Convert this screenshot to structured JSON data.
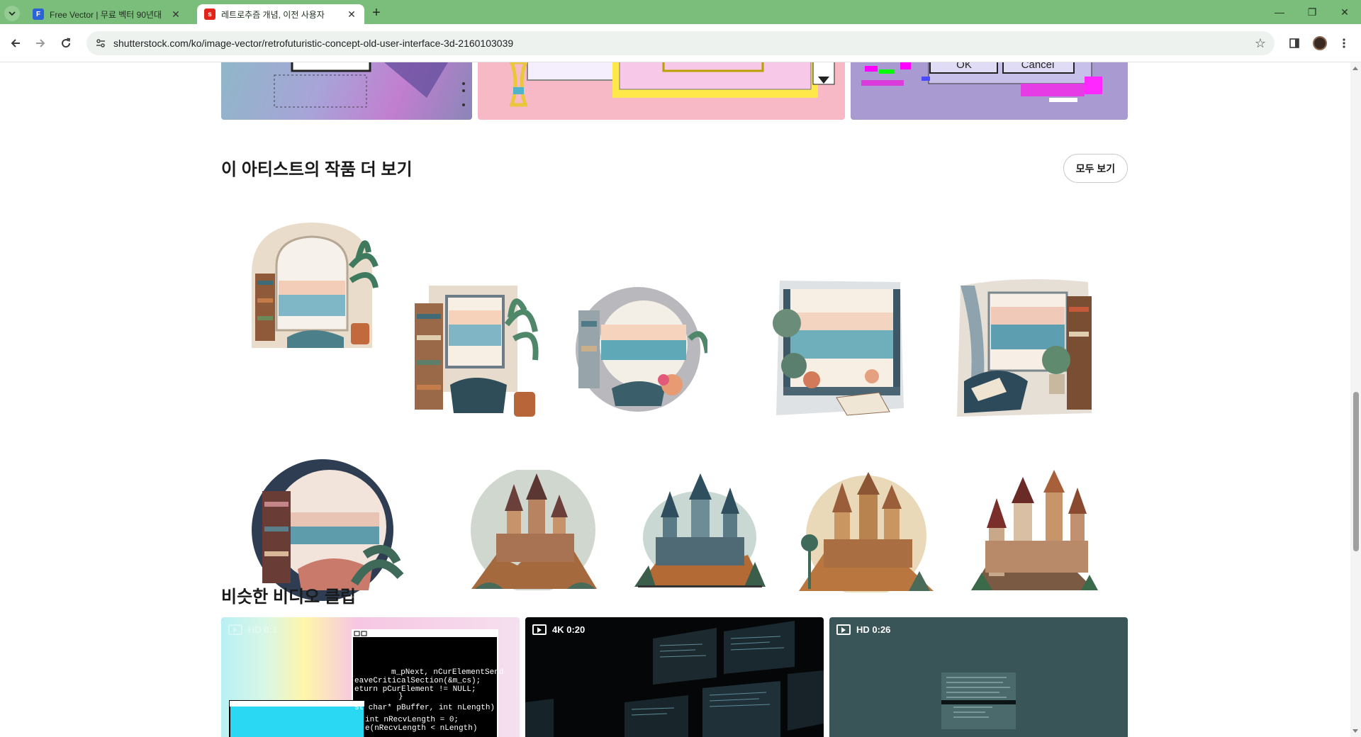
{
  "browser": {
    "tabs": [
      {
        "title": "Free Vector | 무료 벡터 90년대",
        "favicon": "freepik-favicon",
        "active": false
      },
      {
        "title": "레트로추즘 개념, 이전 사용자",
        "favicon": "shutterstock-favicon",
        "active": true
      }
    ],
    "url": "shutterstock.com/ko/image-vector/retrofuturistic-concept-old-user-interface-3d-2160103039"
  },
  "artist_section": {
    "title": "이 아티스트의 작품 더 보기",
    "see_all_label": "모두 보기",
    "images": [
      {
        "name": "artwork-arched-window-sea-room",
        "alt": "arched window sea room watercolor"
      },
      {
        "name": "artwork-open-window-reading-chair",
        "alt": "open window reading chair watercolor"
      },
      {
        "name": "artwork-porthole-sea-view",
        "alt": "porthole sea view watercolor"
      },
      {
        "name": "artwork-window-sea-books",
        "alt": "window with sea and books watercolor"
      },
      {
        "name": "artwork-window-sea-plants",
        "alt": "window sea and plants watercolor"
      },
      {
        "name": "artwork-round-window-reading-nook",
        "alt": "round window reading nook watercolor"
      },
      {
        "name": "artwork-castle-1",
        "alt": "castle illustration"
      },
      {
        "name": "artwork-castle-2",
        "alt": "castle illustration"
      },
      {
        "name": "artwork-castle-3",
        "alt": "castle illustration"
      },
      {
        "name": "artwork-castle-4",
        "alt": "castle illustration"
      }
    ]
  },
  "video_section": {
    "title": "비슷한 비디오 클립",
    "clips": [
      {
        "badge": "HD 0:1"
      },
      {
        "badge": "4K 0:20"
      },
      {
        "badge": "HD 0:26"
      }
    ]
  },
  "code_text": [
    "m_pNext, nCurElementSend",
    "eaveCriticalSection(&m_cs);",
    "eturn pCurElement != NULL;",
    "}",
    "st char* pBuffer, int nLength)",
    "int nRecvLength = 0;",
    "e(nRecvLength < nLength)"
  ],
  "dialog_labels": {
    "ok": "OK",
    "cancel": "Cancel"
  },
  "colors": {
    "tabbar": "#7bbd7b",
    "accent": "#e2231a"
  }
}
